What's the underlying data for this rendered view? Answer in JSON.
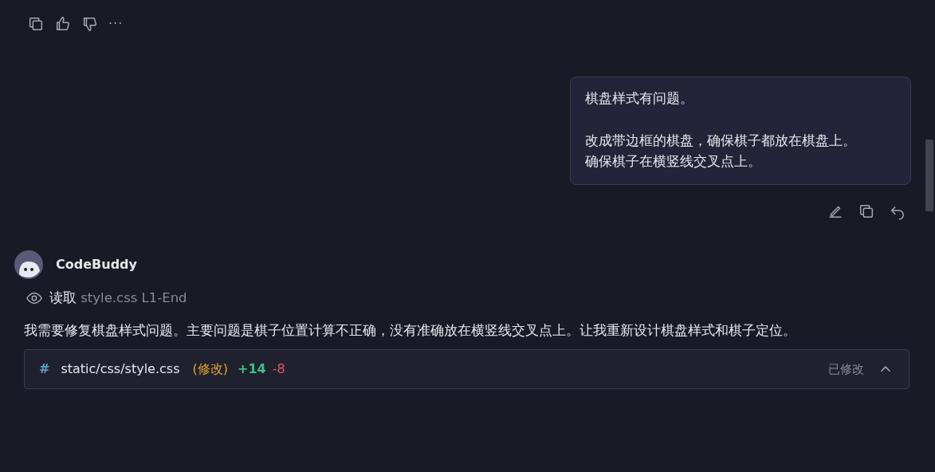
{
  "message_actions": [
    {
      "kind": "copy"
    },
    {
      "kind": "like"
    },
    {
      "kind": "dislike"
    },
    {
      "kind": "more",
      "label": "···"
    }
  ],
  "user_message": {
    "paragraphs": [
      [
        "棋盘样式有问题。"
      ],
      [
        "改成带边框的棋盘，确保棋子都放在棋盘上。",
        "确保棋子在横竖线交叉点上。"
      ]
    ],
    "actions": [
      {
        "kind": "edit"
      },
      {
        "kind": "copy"
      },
      {
        "kind": "undo"
      }
    ]
  },
  "assistant": {
    "name": "CodeBuddy",
    "read_step": {
      "verb": "读取",
      "file": "style.css",
      "range": "L1-End"
    },
    "text": "我需要修复棋盘样式问题。主要问题是棋子位置计算不正确，没有准确放在横竖线交叉点上。让我重新设计棋盘样式和棋子定位。",
    "file_change": {
      "icon": "#",
      "path": "static/css/style.css",
      "status": "(修改)",
      "added": "+14",
      "removed": "-8",
      "state": "已修改",
      "expanded": true
    }
  }
}
